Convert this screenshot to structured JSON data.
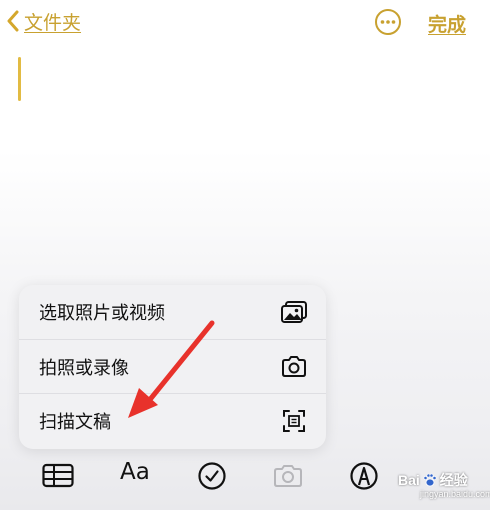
{
  "nav": {
    "back_label": "文件夹",
    "done_label": "完成",
    "icons": {
      "back": "chevron-left-icon",
      "more": "ellipsis-circle-icon"
    }
  },
  "menu": {
    "items": [
      {
        "label": "选取照片或视频",
        "icon": "photo-library-icon"
      },
      {
        "label": "拍照或录像",
        "icon": "camera-icon"
      },
      {
        "label": "扫描文稿",
        "icon": "document-scan-icon"
      }
    ]
  },
  "toolbar": {
    "format_label": "Aa",
    "icons": [
      "table-icon",
      "text-format-icon",
      "checklist-icon",
      "camera-icon",
      "markup-pen-icon"
    ]
  },
  "watermark": {
    "text": "Bai",
    "text2": "经验",
    "sub": "jingyan.baidu.com"
  },
  "colors": {
    "accent": "#c8a130",
    "cursor": "#e2bb43",
    "arrow": "#e8322b"
  }
}
